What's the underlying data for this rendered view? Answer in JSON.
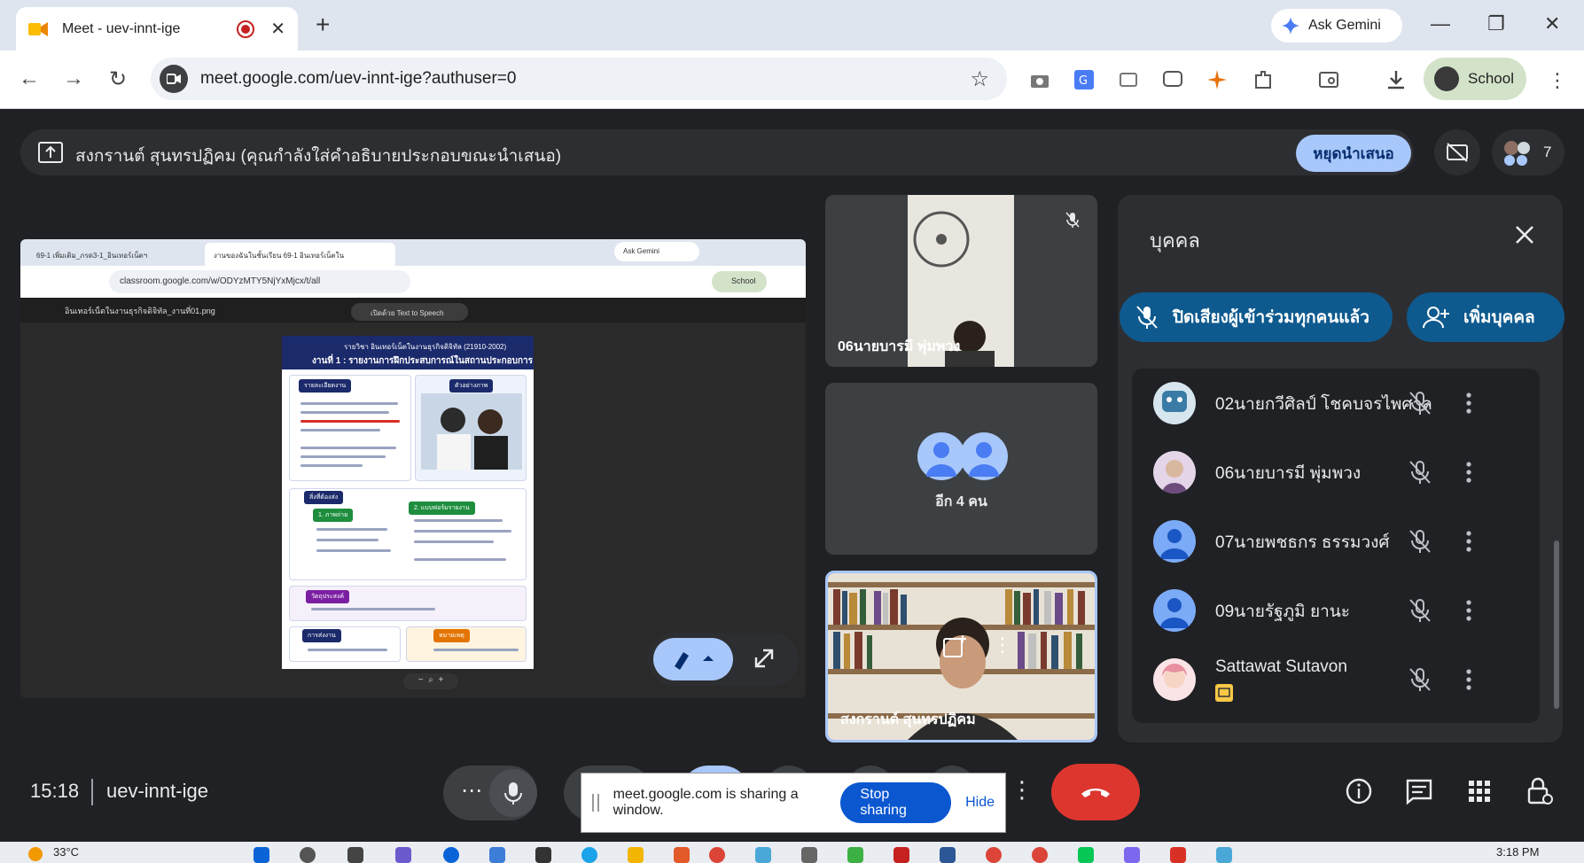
{
  "browser": {
    "tab_title": "Meet - uev-innt-ige",
    "new_tab": "+",
    "ask_gemini": "Ask Gemini",
    "url": "meet.google.com/uev-innt-ige?authuser=0",
    "profile_name": "School"
  },
  "meet": {
    "presenting_text": "สงกรานต์ สุนทรปฏิคม (คุณกำลังใส่คำอธิบายประกอบขณะนำเสนอ)",
    "stop_presenting": "หยุดนำเสนอ",
    "participant_count": "7",
    "clock": "15:18",
    "meeting_code": "uev-innt-ige"
  },
  "shared_screen": {
    "tabs": [
      "69-1 เพิ่มเติม_ภรด3-1_อินเทอร์เน็ตฯ",
      "งานของฉันในชั้นเรียน 69-1 อินเทอร์เน็ตใน"
    ],
    "ask_gemini": "Ask Gemini",
    "url": "classroom.google.com/w/ODYzMTY5NjYxMjcx/t/all",
    "profile_name": "School",
    "file_name": "อินเทอร์เน็ตในงานธุรกิจดิจิทัล_งานที่01.png",
    "tts_label": "เปิดด้วย Text to Speech",
    "poster_subtitle": "รายวิชา อินเทอร์เน็ตในงานธุรกิจดิจิทัล (21910-2002)",
    "poster_title": "งานที่ 1 : รายงานการฝึกประสบการณ์ในสถานประกอบการ",
    "poster_sections": [
      "รายละเอียดงาน",
      "ตัวอย่างภาพ",
      "สิ่งที่ต้องส่ง",
      "1. ภาพถ่าย",
      "2. แบบฟอร์มรายงาน",
      "วัตถุประสงค์",
      "การส่งงาน",
      "หมายเหตุ"
    ]
  },
  "tiles": [
    {
      "name": "06นายบารมี พุ่มพวง"
    },
    {
      "name": "อีก 4 คน"
    },
    {
      "name": "สงกรานต์ สุนทรปฏิคม"
    }
  ],
  "people_panel": {
    "title": "บุคคล",
    "mute_all": "ปิดเสียงผู้เข้าร่วมทุกคนแล้ว",
    "add_people": "เพิ่มบุคคล",
    "participants": [
      {
        "name": "02นายกวีศิลป์ โชคบจรไพศาล"
      },
      {
        "name": "06นายบารมี พุ่มพวง"
      },
      {
        "name": "07นายพชธกร ธรรมวงศ์"
      },
      {
        "name": "09นายรัฐภูมิ ยานะ"
      },
      {
        "name": "Sattawat Sutavon"
      }
    ]
  },
  "share_notice": {
    "text": "meet.google.com is sharing a window.",
    "stop_sharing": "Stop sharing",
    "hide": "Hide"
  },
  "taskbar": {
    "temperature": "33°C",
    "time": "3:18 PM"
  },
  "colors": {
    "meet_bg": "#202124",
    "accent_blue": "#a8c7fa",
    "end_call_red": "#dc362e",
    "panel_bg": "#2d2e31"
  }
}
